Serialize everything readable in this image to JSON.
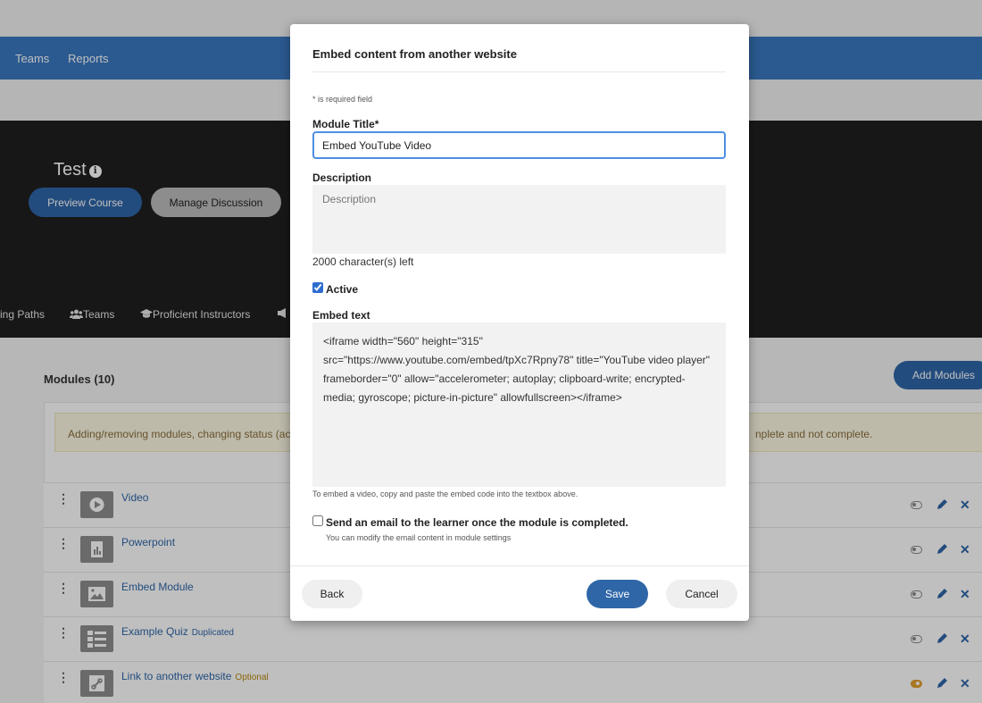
{
  "nav": {
    "teams": "Teams",
    "reports": "Reports"
  },
  "course": {
    "title": "Test",
    "info_icon": "info-icon",
    "preview_label": "Preview Course",
    "discussion_label": "Manage Discussion",
    "tabs": [
      "ing Paths",
      "Teams",
      "Proficient Instructors"
    ]
  },
  "modules": {
    "heading": "Modules (10)",
    "add_label": "Add Modules",
    "notice_left": "Adding/removing modules, changing status (act",
    "notice_right": "nplete and not complete.",
    "rows": [
      {
        "name": "Video",
        "tag": "",
        "toggle": "off"
      },
      {
        "name": "Powerpoint",
        "tag": "",
        "toggle": "off"
      },
      {
        "name": "Embed Module",
        "tag": "",
        "toggle": "off"
      },
      {
        "name": "Example Quiz",
        "tag": "Duplicated",
        "toggle": "off"
      },
      {
        "name": "Link to another website",
        "tag": "Optional",
        "toggle": "on"
      }
    ]
  },
  "modal": {
    "title": "Embed content from another website",
    "required_note": "* is required field",
    "module_title_label": "Module Title*",
    "module_title_value": "Embed YouTube Video",
    "description_label": "Description",
    "description_placeholder": "Description",
    "char_count": "2000 character(s) left",
    "active_label": "Active",
    "active_checked": true,
    "embed_label": "Embed text",
    "embed_value": "<iframe width=\"560\" height=\"315\" src=\"https://www.youtube.com/embed/tpXc7Rpny78\" title=\"YouTube video player\" frameborder=\"0\" allow=\"accelerometer; autoplay; clipboard-write; encrypted-media; gyroscope; picture-in-picture\" allowfullscreen></iframe>",
    "embed_hint": "To embed a video, copy and paste the embed code into the textbox above.",
    "email_label": "Send an email to the learner once the module is completed.",
    "email_sub": "You can modify the email content in module settings",
    "email_checked": false,
    "back_label": "Back",
    "save_label": "Save",
    "cancel_label": "Cancel"
  },
  "colors": {
    "brand": "#3a79c0",
    "button": "#2f66a8",
    "toggle_on": "#e0a030"
  }
}
